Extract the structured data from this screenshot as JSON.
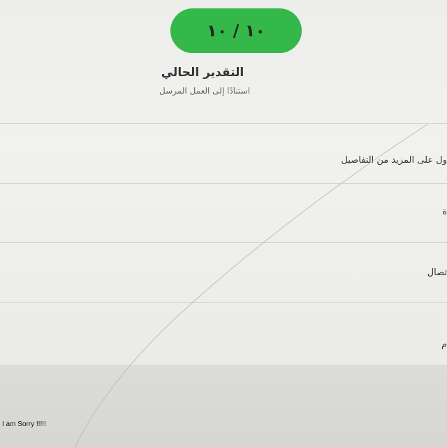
{
  "grade": {
    "score": "١٠ / ١٠",
    "title": "التقدير الحالي",
    "subtitle": "استنادًا إلى العمل المرسل"
  },
  "rows": [
    {
      "label": "ول على المزيد من التفاصيل"
    },
    {
      "label": "ة"
    },
    {
      "label": "تصال"
    },
    {
      "label": "م"
    }
  ],
  "caption": "I am Sorry !!!!!",
  "colors": {
    "accent": "#34b84a"
  }
}
